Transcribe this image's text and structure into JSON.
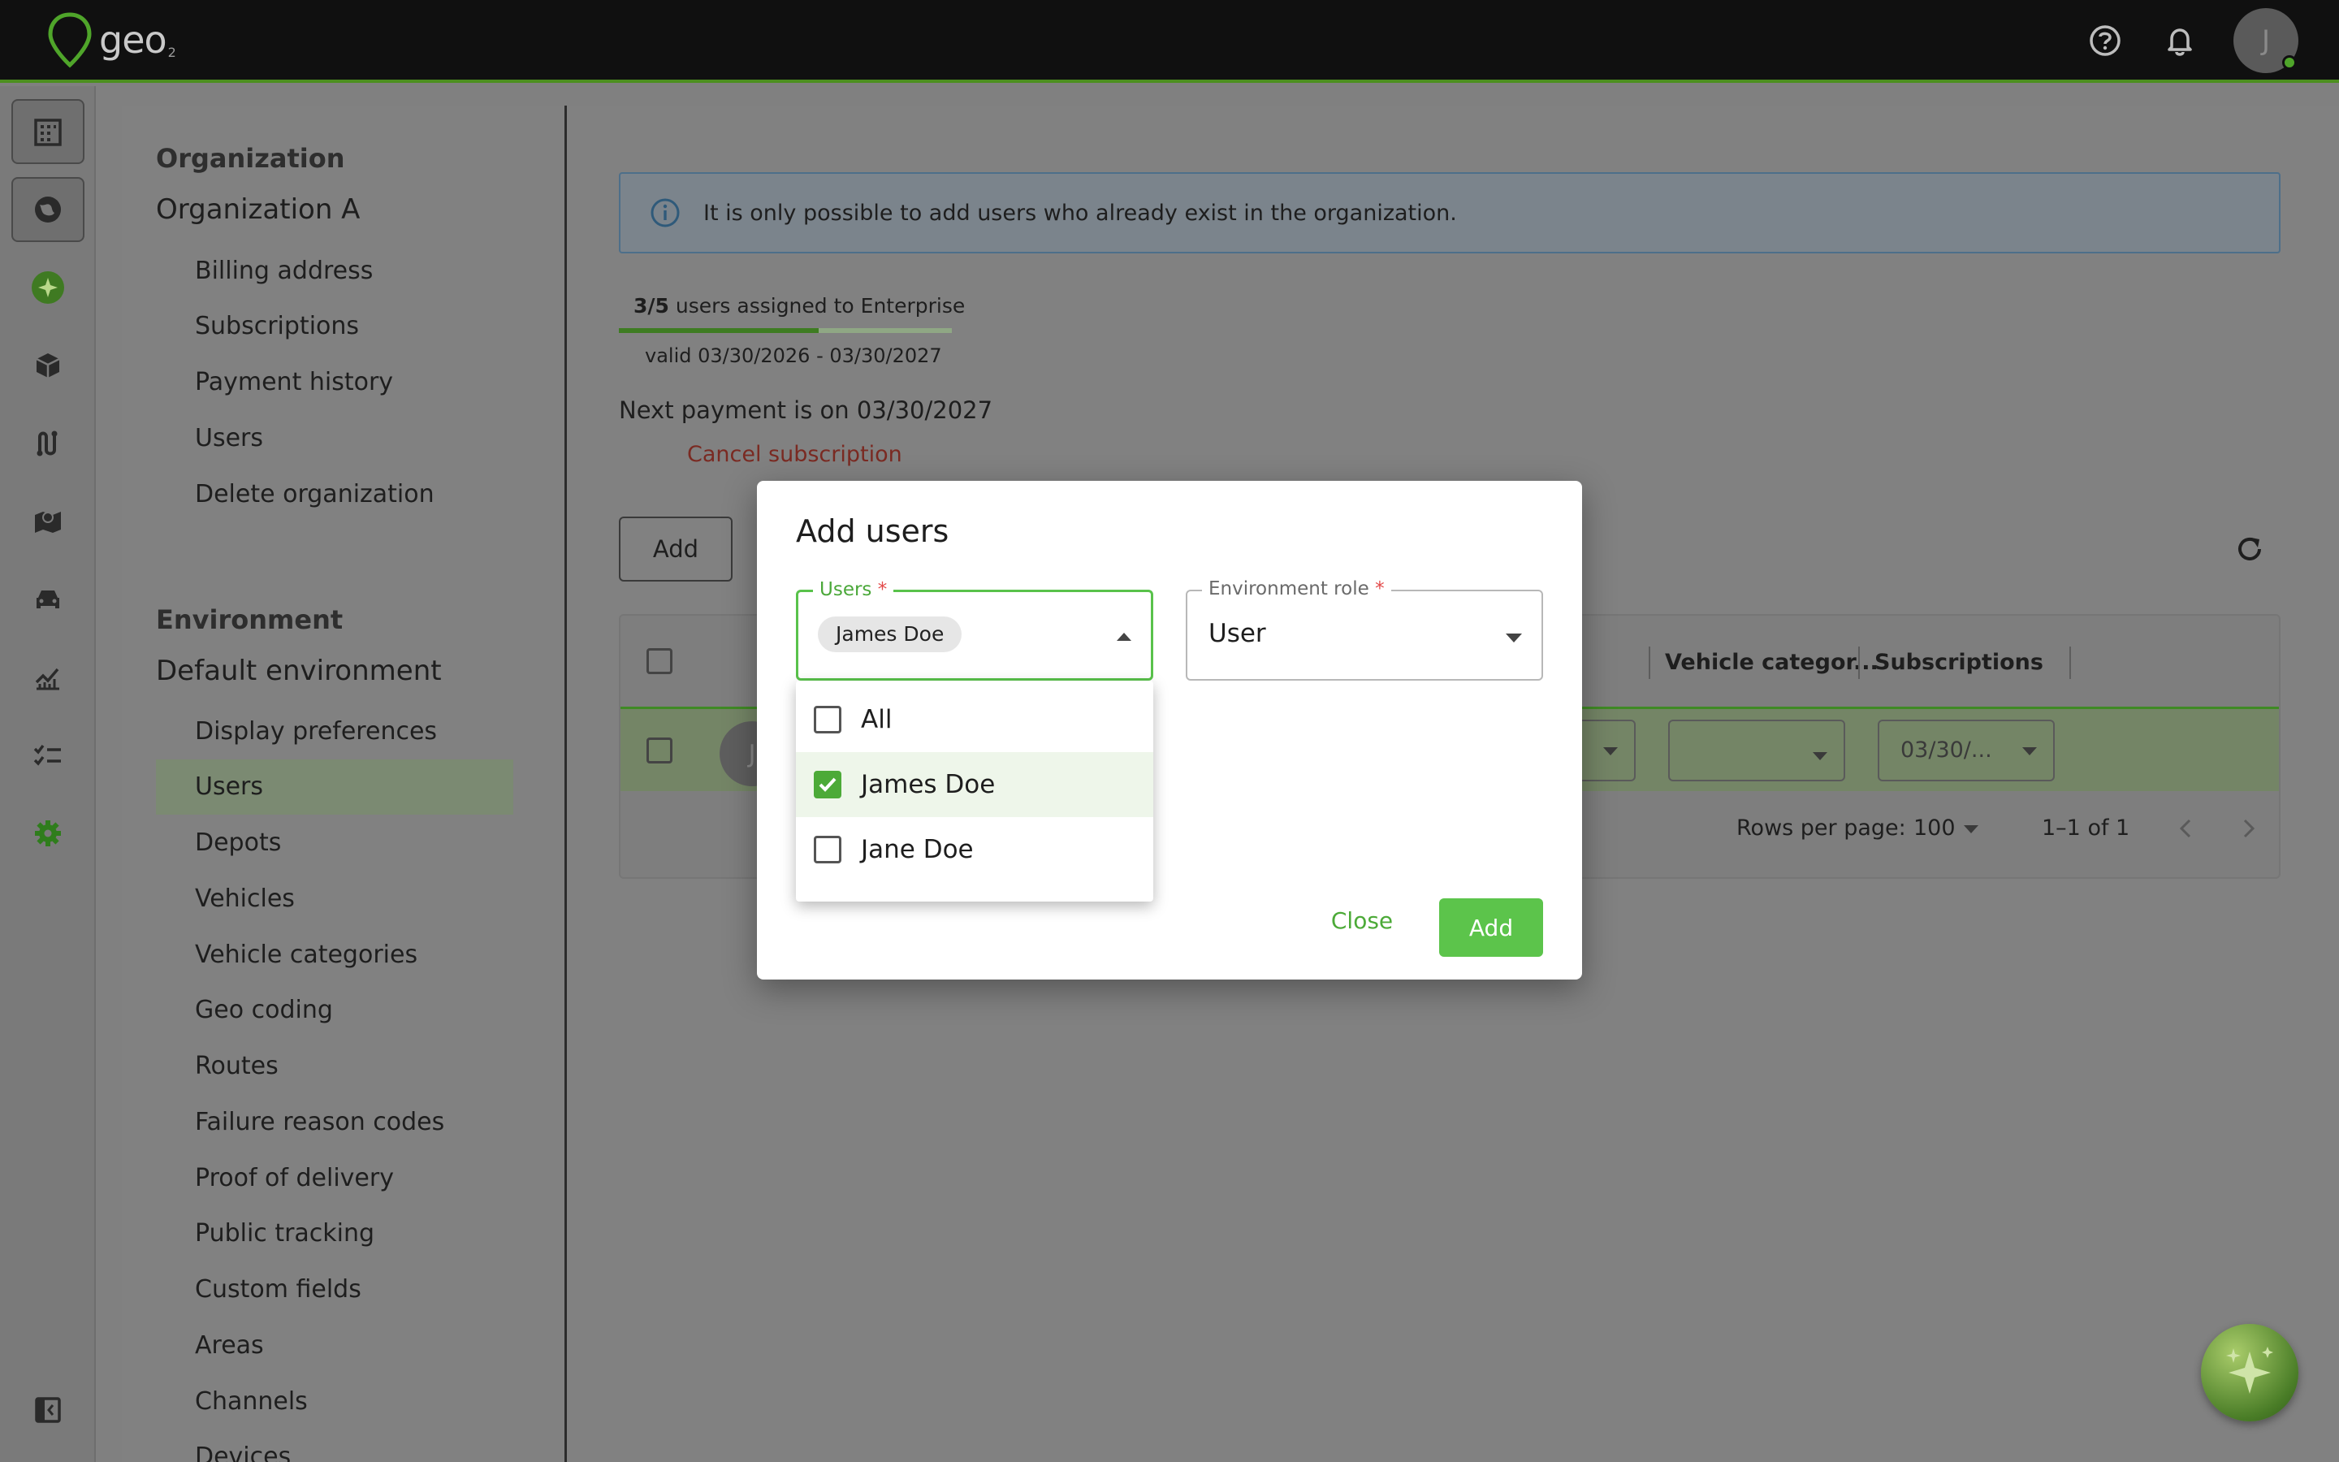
{
  "header": {
    "logo_text": "geo",
    "logo_sub": "2",
    "help_icon": "help-circle-icon",
    "bell_icon": "bell-icon",
    "avatar_initial": "J",
    "accent": "#4c8f1f"
  },
  "rail": {
    "icons": [
      "building-icon",
      "globe-icon",
      "sparkle-icon",
      "package-icon",
      "route-icon",
      "map-icon",
      "car-icon",
      "chart-icon",
      "checklist-icon",
      "gear-icon",
      "collapse-icon"
    ]
  },
  "nav": {
    "org_section": "Organization",
    "org_name": "Organization A",
    "org_items": [
      "Billing address",
      "Subscriptions",
      "Payment history",
      "Users",
      "Delete organization"
    ],
    "env_section": "Environment",
    "env_name": "Default environment",
    "env_items": [
      "Display preferences",
      "Users",
      "Depots",
      "Vehicles",
      "Vehicle categories",
      "Geo coding",
      "Routes",
      "Failure reason codes",
      "Proof of delivery",
      "Public tracking",
      "Custom fields",
      "Areas",
      "Channels",
      "Devices"
    ],
    "active_item": "Users"
  },
  "main": {
    "info_text": "It is only possible to add users who already exist in the organization.",
    "assigned_count": "3/5",
    "assigned_text": "users assigned to Enterprise",
    "assigned_progress": 0.6,
    "valid_text": "valid 03/30/2026 - 03/30/2027",
    "next_payment": "Next payment is on 03/30/2027",
    "cancel_label": "Cancel subscription",
    "add_label": "Add",
    "columns": [
      "Vehicle categor...",
      "Subscriptions"
    ],
    "row_avatar_initial": "J",
    "row_subscription_value": "03/30/...",
    "rows_per_page_label": "Rows per page:",
    "rows_per_page_value": "100",
    "pagination": "1–1 of 1"
  },
  "modal": {
    "title": "Add users",
    "users_label": "Users",
    "users_required": "*",
    "selected_chip": "James Doe",
    "role_label": "Environment role",
    "role_required": "*",
    "role_value": "User",
    "options": [
      {
        "label": "All",
        "checked": false
      },
      {
        "label": "James Doe",
        "checked": true
      },
      {
        "label": "Jane Doe",
        "checked": false
      }
    ],
    "close_label": "Close",
    "add_label": "Add"
  }
}
